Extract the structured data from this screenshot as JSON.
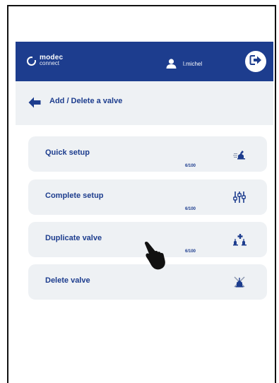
{
  "header": {
    "logo_main": "modec",
    "logo_sub": "connect",
    "username": "l.michel"
  },
  "page": {
    "title": "Add / Delete a valve"
  },
  "menu": [
    {
      "label": "Quick setup",
      "count": "6/100",
      "icon": "quick-setup-icon"
    },
    {
      "label": "Complete setup",
      "count": "6/100",
      "icon": "sliders-icon"
    },
    {
      "label": "Duplicate valve",
      "count": "6/100",
      "icon": "duplicate-valve-icon"
    },
    {
      "label": "Delete valve",
      "count": "",
      "icon": "delete-valve-icon"
    }
  ],
  "colors": {
    "primary": "#1d3d8e",
    "header_bg": "#1d3d8e",
    "panel_bg": "#eef1f4"
  }
}
